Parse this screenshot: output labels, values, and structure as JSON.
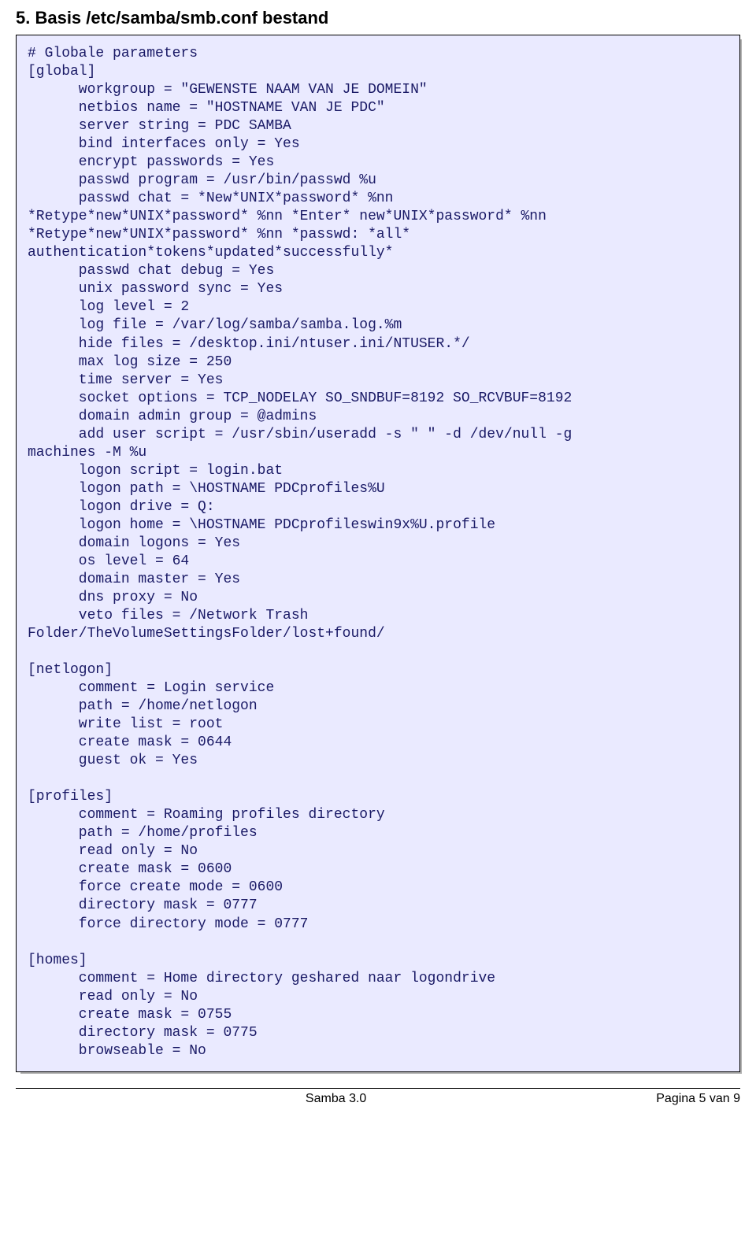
{
  "heading": "5. Basis /etc/samba/smb.conf bestand",
  "code_lines": [
    "# Globale parameters",
    "[global]",
    "      workgroup = \"GEWENSTE NAAM VAN JE DOMEIN\"",
    "      netbios name = \"HOSTNAME VAN JE PDC\"",
    "      server string = PDC SAMBA",
    "      bind interfaces only = Yes",
    "      encrypt passwords = Yes",
    "      passwd program = /usr/bin/passwd %u",
    "      passwd chat = *New*UNIX*password* %nn",
    "*Retype*new*UNIX*password* %nn *Enter* new*UNIX*password* %nn",
    "*Retype*new*UNIX*password* %nn *passwd: *all*",
    "authentication*tokens*updated*successfully*",
    "      passwd chat debug = Yes",
    "      unix password sync = Yes",
    "      log level = 2",
    "      log file = /var/log/samba/samba.log.%m",
    "      hide files = /desktop.ini/ntuser.ini/NTUSER.*/",
    "      max log size = 250",
    "      time server = Yes",
    "      socket options = TCP_NODELAY SO_SNDBUF=8192 SO_RCVBUF=8192",
    "      domain admin group = @admins",
    "      add user script = /usr/sbin/useradd -s \" \" -d /dev/null -g",
    "machines -M %u",
    "      logon script = login.bat",
    "      logon path = \\HOSTNAME PDCprofiles%U",
    "      logon drive = Q:",
    "      logon home = \\HOSTNAME PDCprofileswin9x%U.profile",
    "      domain logons = Yes",
    "      os level = 64",
    "      domain master = Yes",
    "      dns proxy = No",
    "      veto files = /Network Trash",
    "Folder/TheVolumeSettingsFolder/lost+found/",
    "",
    "[netlogon]",
    "      comment = Login service",
    "      path = /home/netlogon",
    "      write list = root",
    "      create mask = 0644",
    "      guest ok = Yes",
    "",
    "[profiles]",
    "      comment = Roaming profiles directory",
    "      path = /home/profiles",
    "      read only = No",
    "      create mask = 0600",
    "      force create mode = 0600",
    "      directory mask = 0777",
    "      force directory mode = 0777",
    "",
    "[homes]",
    "      comment = Home directory geshared naar logondrive",
    "      read only = No",
    "      create mask = 0755",
    "      directory mask = 0775",
    "      browseable = No"
  ],
  "footer": {
    "center": "Samba 3.0",
    "right": "Pagina 5 van 9"
  }
}
